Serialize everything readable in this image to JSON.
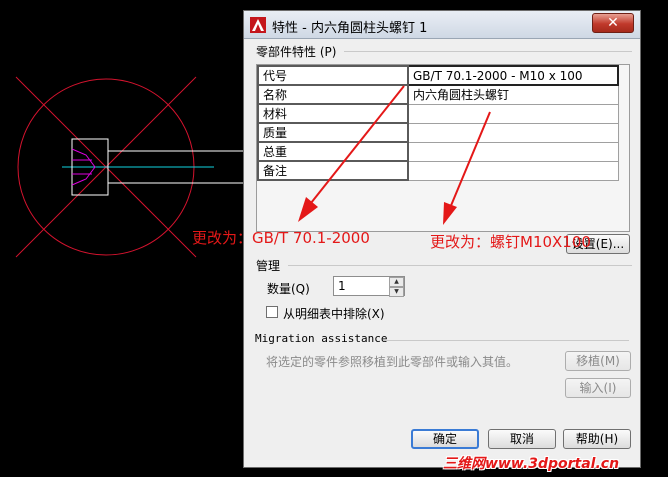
{
  "dialog": {
    "title": "特性 - 内六角圆柱头螺钉 1",
    "close_symbol": "✕",
    "properties_group": "零部件特性 (P)",
    "properties": [
      {
        "key": "代号",
        "value": "GB/T 70.1-2000 - M10 x 100"
      },
      {
        "key": "名称",
        "value": "内六角圆柱头螺钉"
      },
      {
        "key": "材料",
        "value": ""
      },
      {
        "key": "质量",
        "value": ""
      },
      {
        "key": "总重",
        "value": ""
      },
      {
        "key": "备注",
        "value": ""
      }
    ],
    "settings_button": "设置(E)...",
    "manage_group": "管理",
    "quantity_label": "数量(Q)",
    "quantity_value": "1",
    "exclude_label": "从明细表中排除(X)",
    "migration_group": "Migration assistance",
    "migration_hint": "将选定的零件参照移植到此零部件或输入其值。",
    "migrate_button": "移植(M)",
    "import_button": "输入(I)",
    "ok_button": "确定",
    "cancel_button": "取消",
    "help_button": "帮助(H)"
  },
  "annotations": {
    "left": "更改为：GB/T 70.1-2000",
    "right": "更改为：螺钉M10X100"
  },
  "watermark": "三维网www.3dportal.cn",
  "colors": {
    "cad_background": "#000000",
    "circle": "#d4132e",
    "centerline": "#0fd3e0",
    "annotation": "#e41818",
    "magenta": "#e000e0"
  }
}
